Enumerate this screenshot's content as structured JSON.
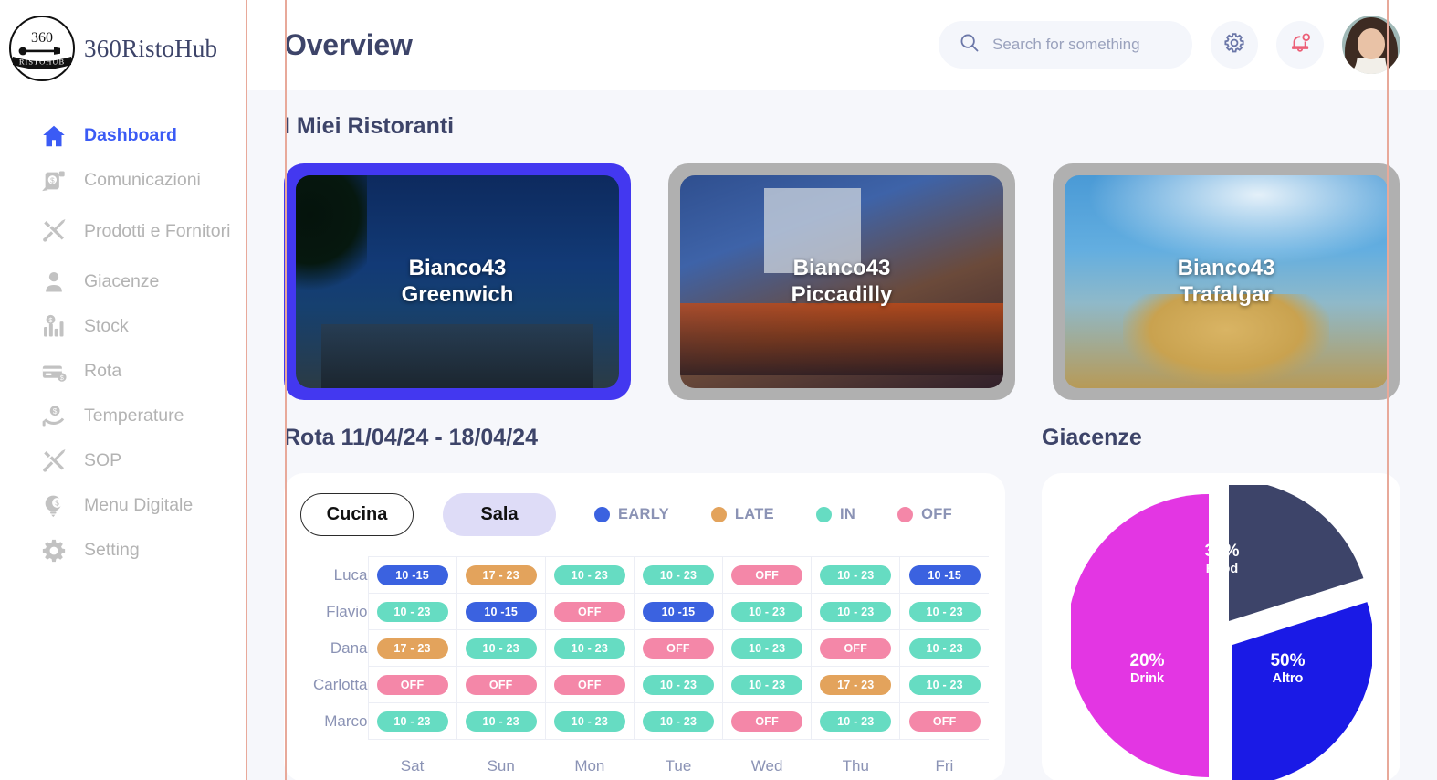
{
  "brand": {
    "name": "360RistoHub",
    "logo_text_top": "360",
    "logo_text_bottom": "RISTOHUB"
  },
  "sidebar": {
    "items": [
      {
        "label": "Dashboard",
        "icon": "home-icon",
        "active": true
      },
      {
        "label": "Comunicazioni",
        "icon": "message-money-icon",
        "active": false
      },
      {
        "label": "Prodotti e Fornitori",
        "icon": "tools-icon",
        "active": false
      },
      {
        "label": "Giacenze",
        "icon": "user-icon",
        "active": false
      },
      {
        "label": "Stock",
        "icon": "bar-chart-money-icon",
        "active": false
      },
      {
        "label": "Rota",
        "icon": "card-money-icon",
        "active": false
      },
      {
        "label": "Temperature",
        "icon": "hand-money-icon",
        "active": false
      },
      {
        "label": "SOP",
        "icon": "tools-icon",
        "active": false
      },
      {
        "label": "Menu Digitale",
        "icon": "bulb-money-icon",
        "active": false
      },
      {
        "label": "Setting",
        "icon": "gear-icon",
        "active": false
      }
    ]
  },
  "header": {
    "title": "Overview",
    "search": {
      "placeholder": "Search for something",
      "value": "",
      "icon": "search-icon"
    },
    "settings_icon": "gear-icon",
    "notifications_icon": "bell-icon",
    "avatar": "user-avatar"
  },
  "restaurants": {
    "title": "I Miei Ristoranti",
    "cards": [
      {
        "name_line1": "Bianco43",
        "name_line2": "Greenwich",
        "selected": true
      },
      {
        "name_line1": "Bianco43",
        "name_line2": "Piccadilly",
        "selected": false
      },
      {
        "name_line1": "Bianco43",
        "name_line2": "Trafalgar",
        "selected": false
      }
    ]
  },
  "rota": {
    "title": "Rota 11/04/24 - 18/04/24",
    "tabs": [
      {
        "label": "Cucina",
        "active": true
      },
      {
        "label": "Sala",
        "active": false
      }
    ],
    "legend": [
      {
        "label": "EARLY",
        "color": "#3b62e0"
      },
      {
        "label": "LATE",
        "color": "#e3a35c"
      },
      {
        "label": "IN",
        "color": "#66dcc2"
      },
      {
        "label": "OFF",
        "color": "#f487a8"
      }
    ],
    "days": [
      "Sat",
      "Sun",
      "Mon",
      "Tue",
      "Wed",
      "Thu",
      "Fri"
    ],
    "rows": [
      {
        "name": "Luca",
        "shifts": [
          {
            "text": "10 -15",
            "type": "early"
          },
          {
            "text": "17 - 23",
            "type": "late"
          },
          {
            "text": "10 - 23",
            "type": "in"
          },
          {
            "text": "10 - 23",
            "type": "in"
          },
          {
            "text": "OFF",
            "type": "off"
          },
          {
            "text": "10 - 23",
            "type": "in"
          },
          {
            "text": "10 -15",
            "type": "early"
          }
        ]
      },
      {
        "name": "Flavio",
        "shifts": [
          {
            "text": "10 - 23",
            "type": "in"
          },
          {
            "text": "10 -15",
            "type": "early"
          },
          {
            "text": "OFF",
            "type": "off"
          },
          {
            "text": "10 -15",
            "type": "early"
          },
          {
            "text": "10 - 23",
            "type": "in"
          },
          {
            "text": "10 - 23",
            "type": "in"
          },
          {
            "text": "10 - 23",
            "type": "in"
          }
        ]
      },
      {
        "name": "Dana",
        "shifts": [
          {
            "text": "17 - 23",
            "type": "late"
          },
          {
            "text": "10 - 23",
            "type": "in"
          },
          {
            "text": "10 - 23",
            "type": "in"
          },
          {
            "text": "OFF",
            "type": "off"
          },
          {
            "text": "10 - 23",
            "type": "in"
          },
          {
            "text": "OFF",
            "type": "off"
          },
          {
            "text": "10 - 23",
            "type": "in"
          }
        ]
      },
      {
        "name": "Carlotta",
        "shifts": [
          {
            "text": "OFF",
            "type": "off"
          },
          {
            "text": "OFF",
            "type": "off"
          },
          {
            "text": "OFF",
            "type": "off"
          },
          {
            "text": "10 - 23",
            "type": "in"
          },
          {
            "text": "10 - 23",
            "type": "in"
          },
          {
            "text": "17 - 23",
            "type": "late"
          },
          {
            "text": "10 - 23",
            "type": "in"
          }
        ]
      },
      {
        "name": "Marco",
        "shifts": [
          {
            "text": "10 - 23",
            "type": "in"
          },
          {
            "text": "10 - 23",
            "type": "in"
          },
          {
            "text": "10 - 23",
            "type": "in"
          },
          {
            "text": "10 - 23",
            "type": "in"
          },
          {
            "text": "OFF",
            "type": "off"
          },
          {
            "text": "10 - 23",
            "type": "in"
          },
          {
            "text": "OFF",
            "type": "off"
          }
        ]
      }
    ]
  },
  "giacenze": {
    "title": "Giacenze"
  },
  "chart_data": {
    "type": "pie",
    "title": "Giacenze",
    "labels": [
      "Food",
      "Altro",
      "Drink"
    ],
    "values": [
      30,
      50,
      20
    ],
    "value_suffix": "%",
    "colors": [
      "#3d4469",
      "#1a1ae6",
      "#e336e3"
    ],
    "legend": "none",
    "exploded": true,
    "slices": [
      {
        "label": "Food",
        "value": 30,
        "display": "30%",
        "color": "#3d4469",
        "start_deg": 0,
        "end_deg": 108
      },
      {
        "label": "Altro",
        "value": 50,
        "display": "50%",
        "color": "#1a1ae6",
        "start_deg": 108,
        "end_deg": 288
      },
      {
        "label": "Drink",
        "value": 20,
        "display": "20%",
        "color": "#e336e3",
        "start_deg": 288,
        "end_deg": 360
      }
    ]
  }
}
